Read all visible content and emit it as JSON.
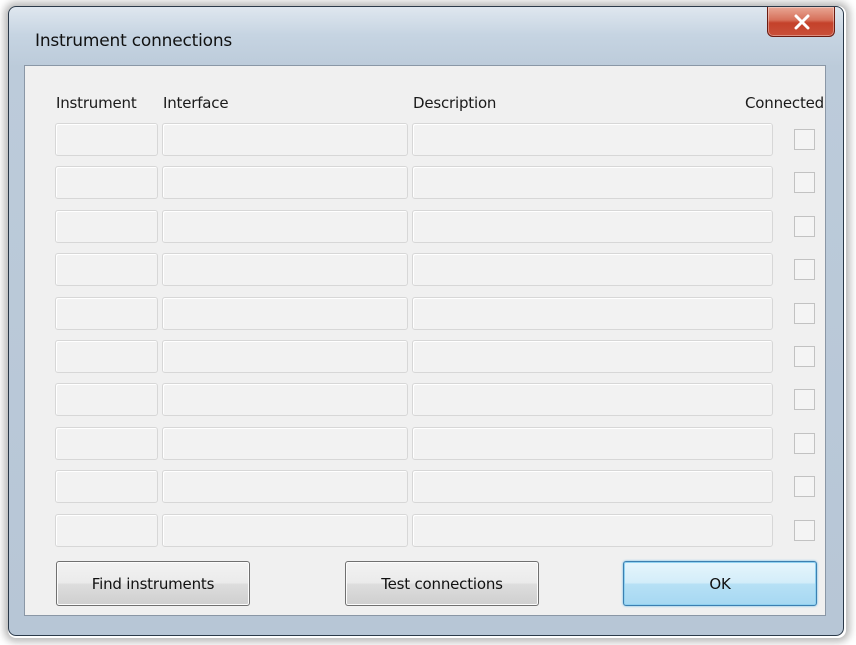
{
  "window": {
    "title": "Instrument connections"
  },
  "columns": {
    "instrument": "Instrument",
    "interface": "Interface",
    "description": "Description",
    "connected": "Connected"
  },
  "rows": [
    {
      "instrument": "",
      "interface": "",
      "description": "",
      "connected": false
    },
    {
      "instrument": "",
      "interface": "",
      "description": "",
      "connected": false
    },
    {
      "instrument": "",
      "interface": "",
      "description": "",
      "connected": false
    },
    {
      "instrument": "",
      "interface": "",
      "description": "",
      "connected": false
    },
    {
      "instrument": "",
      "interface": "",
      "description": "",
      "connected": false
    },
    {
      "instrument": "",
      "interface": "",
      "description": "",
      "connected": false
    },
    {
      "instrument": "",
      "interface": "",
      "description": "",
      "connected": false
    },
    {
      "instrument": "",
      "interface": "",
      "description": "",
      "connected": false
    },
    {
      "instrument": "",
      "interface": "",
      "description": "",
      "connected": false
    },
    {
      "instrument": "",
      "interface": "",
      "description": "",
      "connected": false
    }
  ],
  "buttons": {
    "find": "Find instruments",
    "test": "Test connections",
    "ok": "OK"
  },
  "icons": {
    "close": "close-icon"
  },
  "colors": {
    "close_button": "#c4412a",
    "default_button_border": "#3c7fb1",
    "client_background": "#f0f0f0"
  }
}
